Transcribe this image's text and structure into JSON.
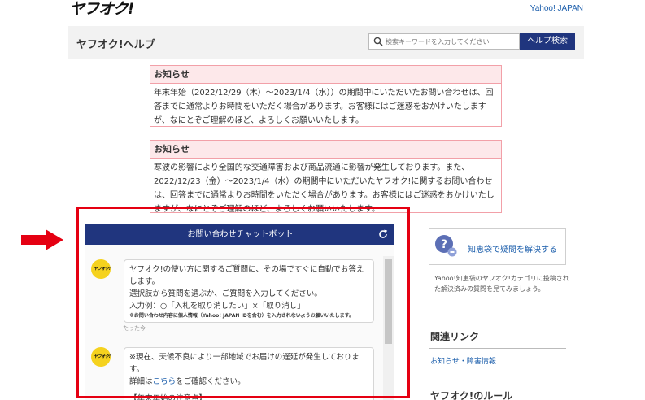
{
  "header": {
    "logo_text": "ヤフオク!",
    "yahoo_link": "Yahoo! JAPAN"
  },
  "help_bar": {
    "title": "ヤフオク!ヘルプ",
    "search_placeholder": "検索キーワードを入力してください",
    "search_button": "ヘルプ検索"
  },
  "notices": [
    {
      "heading": "お知らせ",
      "body": "年末年始（2022/12/29（木）～2023/1/4（水））の期間中にいただいたお問い合わせは、回答までに通常よりお時間をいただく場合があります。お客様にはご迷惑をおかけいたしますが、なにとぞご理解のほど、よろしくお願いいたします。"
    },
    {
      "heading": "お知らせ",
      "body": "寒波の影響により全国的な交通障害および商品流通に影響が発生しております。また、2022/12/23（金）～2023/1/4（水）の期間中にいただいたヤフオク!に関するお問い合わせは、回答までに通常よりお時間をいただく場合があります。お客様にはご迷惑をおかけいたしますが、なにとぞご理解のほど、よろしくお願いいたします。"
    }
  ],
  "chat": {
    "title": "お問い合わせチャットボット",
    "avatar_text": "ヤフオク!",
    "message1": {
      "line1": "ヤフオク!の使い方に関するご質問に、その場ですぐに自動でお答えします。",
      "line2": "選択肢から質問を選ぶか、ご質問を入力してください。",
      "line3": "入力例：○「入札を取り消したい」×「取り消し」",
      "note": "※お問い合わせ内容に個人情報（Yahoo! JAPAN IDを含む）を入力されないようお願いいたします。",
      "time": "たった今"
    },
    "message2": {
      "line1": "※現在、天候不良により一部地域でお届けの遅延が発生しております。",
      "line2_pre": "詳細は",
      "line2_link": "こちら",
      "line2_post": "をご確認ください。",
      "line3": "【年末年始の注意点】"
    }
  },
  "sidebar": {
    "chiebukuro_button": "知恵袋で疑問を解決する",
    "chiebukuro_desc": "Yahoo!知恵袋のヤフオク!カテゴリに投稿された解決済みの質問を見てみましょう。",
    "related_title": "関連リンク",
    "related_link": "お知らせ・障害情報",
    "rules_title": "ヤフオク!のルール"
  },
  "colors": {
    "brand_navy": "#20357e",
    "annotation_red": "#e50012",
    "notice_border": "#f2a0a8",
    "notice_bg": "#fde8ea",
    "avatar_yellow": "#f5d21e"
  }
}
